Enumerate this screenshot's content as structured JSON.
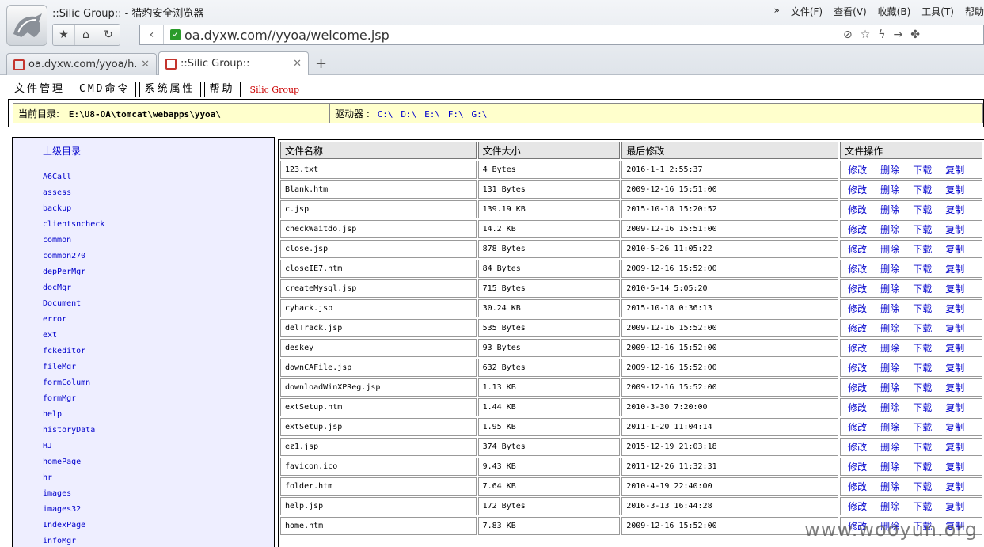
{
  "browser": {
    "window_title": "::Silic Group:: - 猎豹安全浏览器",
    "menu": [
      "文件(F)",
      "查看(V)",
      "收藏(B)",
      "工具(T)",
      "帮助"
    ],
    "url": "oa.dyxw.com//yyoa/welcome.jsp",
    "tabs": [
      {
        "label": "oa.dyxw.com/yyoa/h..."
      },
      {
        "label": "::Silic Group::"
      }
    ],
    "new_tab": "+"
  },
  "topmenu": {
    "file_manage": "文件管理",
    "cmd": "CMD命令",
    "sys_props": "系统属性",
    "help": "帮助",
    "brand": "Silic Group"
  },
  "pathbar": {
    "current_label": "当前目录:",
    "current_path": "E:\\U8-OA\\tomcat\\webapps\\yyoa\\",
    "drives_label": "驱动器 :",
    "drives": [
      "C:\\",
      "D:\\",
      "E:\\",
      "F:\\",
      "G:\\"
    ]
  },
  "sidebar": {
    "parent_dir": "上级目录",
    "separator": "- - - - - - - - - - -",
    "dirs": [
      "A6Call",
      "assess",
      "backup",
      "clientsncheck",
      "common",
      "common270",
      "depPerMgr",
      "docMgr",
      "Document",
      "error",
      "ext",
      "fckeditor",
      "fileMgr",
      "formColumn",
      "formMgr",
      "help",
      "historyData",
      "HJ",
      "homePage",
      "hr",
      "images",
      "images32",
      "IndexPage",
      "infoMgr"
    ]
  },
  "table": {
    "headers": [
      "文件名称",
      "文件大小",
      "最后修改",
      "文件操作"
    ],
    "ops": [
      "修改",
      "删除",
      "下载",
      "复制"
    ],
    "rows": [
      [
        "123.txt",
        "4 Bytes",
        "2016-1-1 2:55:37"
      ],
      [
        "Blank.htm",
        "131 Bytes",
        "2009-12-16 15:51:00"
      ],
      [
        "c.jsp",
        "139.19 KB",
        "2015-10-18 15:20:52"
      ],
      [
        "checkWaitdo.jsp",
        "14.2 KB",
        "2009-12-16 15:51:00"
      ],
      [
        "close.jsp",
        "878 Bytes",
        "2010-5-26 11:05:22"
      ],
      [
        "closeIE7.htm",
        "84 Bytes",
        "2009-12-16 15:52:00"
      ],
      [
        "createMysql.jsp",
        "715 Bytes",
        "2010-5-14 5:05:20"
      ],
      [
        "cyhack.jsp",
        "30.24 KB",
        "2015-10-18 0:36:13"
      ],
      [
        "delTrack.jsp",
        "535 Bytes",
        "2009-12-16 15:52:00"
      ],
      [
        "deskey",
        "93 Bytes",
        "2009-12-16 15:52:00"
      ],
      [
        "downCAFile.jsp",
        "632 Bytes",
        "2009-12-16 15:52:00"
      ],
      [
        "downloadWinXPReg.jsp",
        "1.13 KB",
        "2009-12-16 15:52:00"
      ],
      [
        "extSetup.htm",
        "1.44 KB",
        "2010-3-30 7:20:00"
      ],
      [
        "extSetup.jsp",
        "1.95 KB",
        "2011-1-20 11:04:14"
      ],
      [
        "ez1.jsp",
        "374 Bytes",
        "2015-12-19 21:03:18"
      ],
      [
        "favicon.ico",
        "9.43 KB",
        "2011-12-26 11:32:31"
      ],
      [
        "folder.htm",
        "7.64 KB",
        "2010-4-19 22:40:00"
      ],
      [
        "help.jsp",
        "172 Bytes",
        "2016-3-13 16:44:28"
      ],
      [
        "home.htm",
        "7.83 KB",
        "2009-12-16 15:52:00"
      ]
    ]
  },
  "watermark": "www.wooyun.org"
}
